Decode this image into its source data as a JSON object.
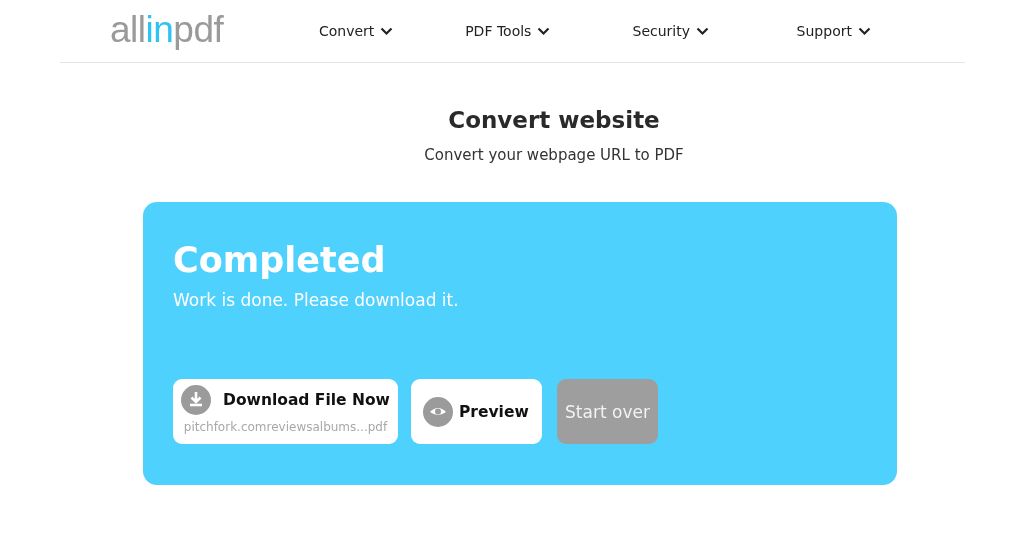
{
  "logo": [
    {
      "text": "all",
      "accent": false
    },
    {
      "text": "in",
      "accent": true
    },
    {
      "text": "pdf",
      "accent": false
    }
  ],
  "nav": [
    {
      "label": "Convert"
    },
    {
      "label": "PDF Tools"
    },
    {
      "label": "Security"
    },
    {
      "label": "Support"
    }
  ],
  "heading": {
    "title": "Convert website",
    "subtitle": "Convert your webpage URL to PDF"
  },
  "result": {
    "title": "Completed",
    "message": "Work is done. Please download it.",
    "buttons": [
      {
        "kind": "download",
        "label": "Download File Now",
        "filename": "pitchfork.comreviewsalbums...pdf",
        "disabled": false
      },
      {
        "kind": "preview",
        "label": "Preview",
        "disabled": false
      },
      {
        "kind": "plain",
        "label": "Start over",
        "disabled": true
      }
    ]
  }
}
